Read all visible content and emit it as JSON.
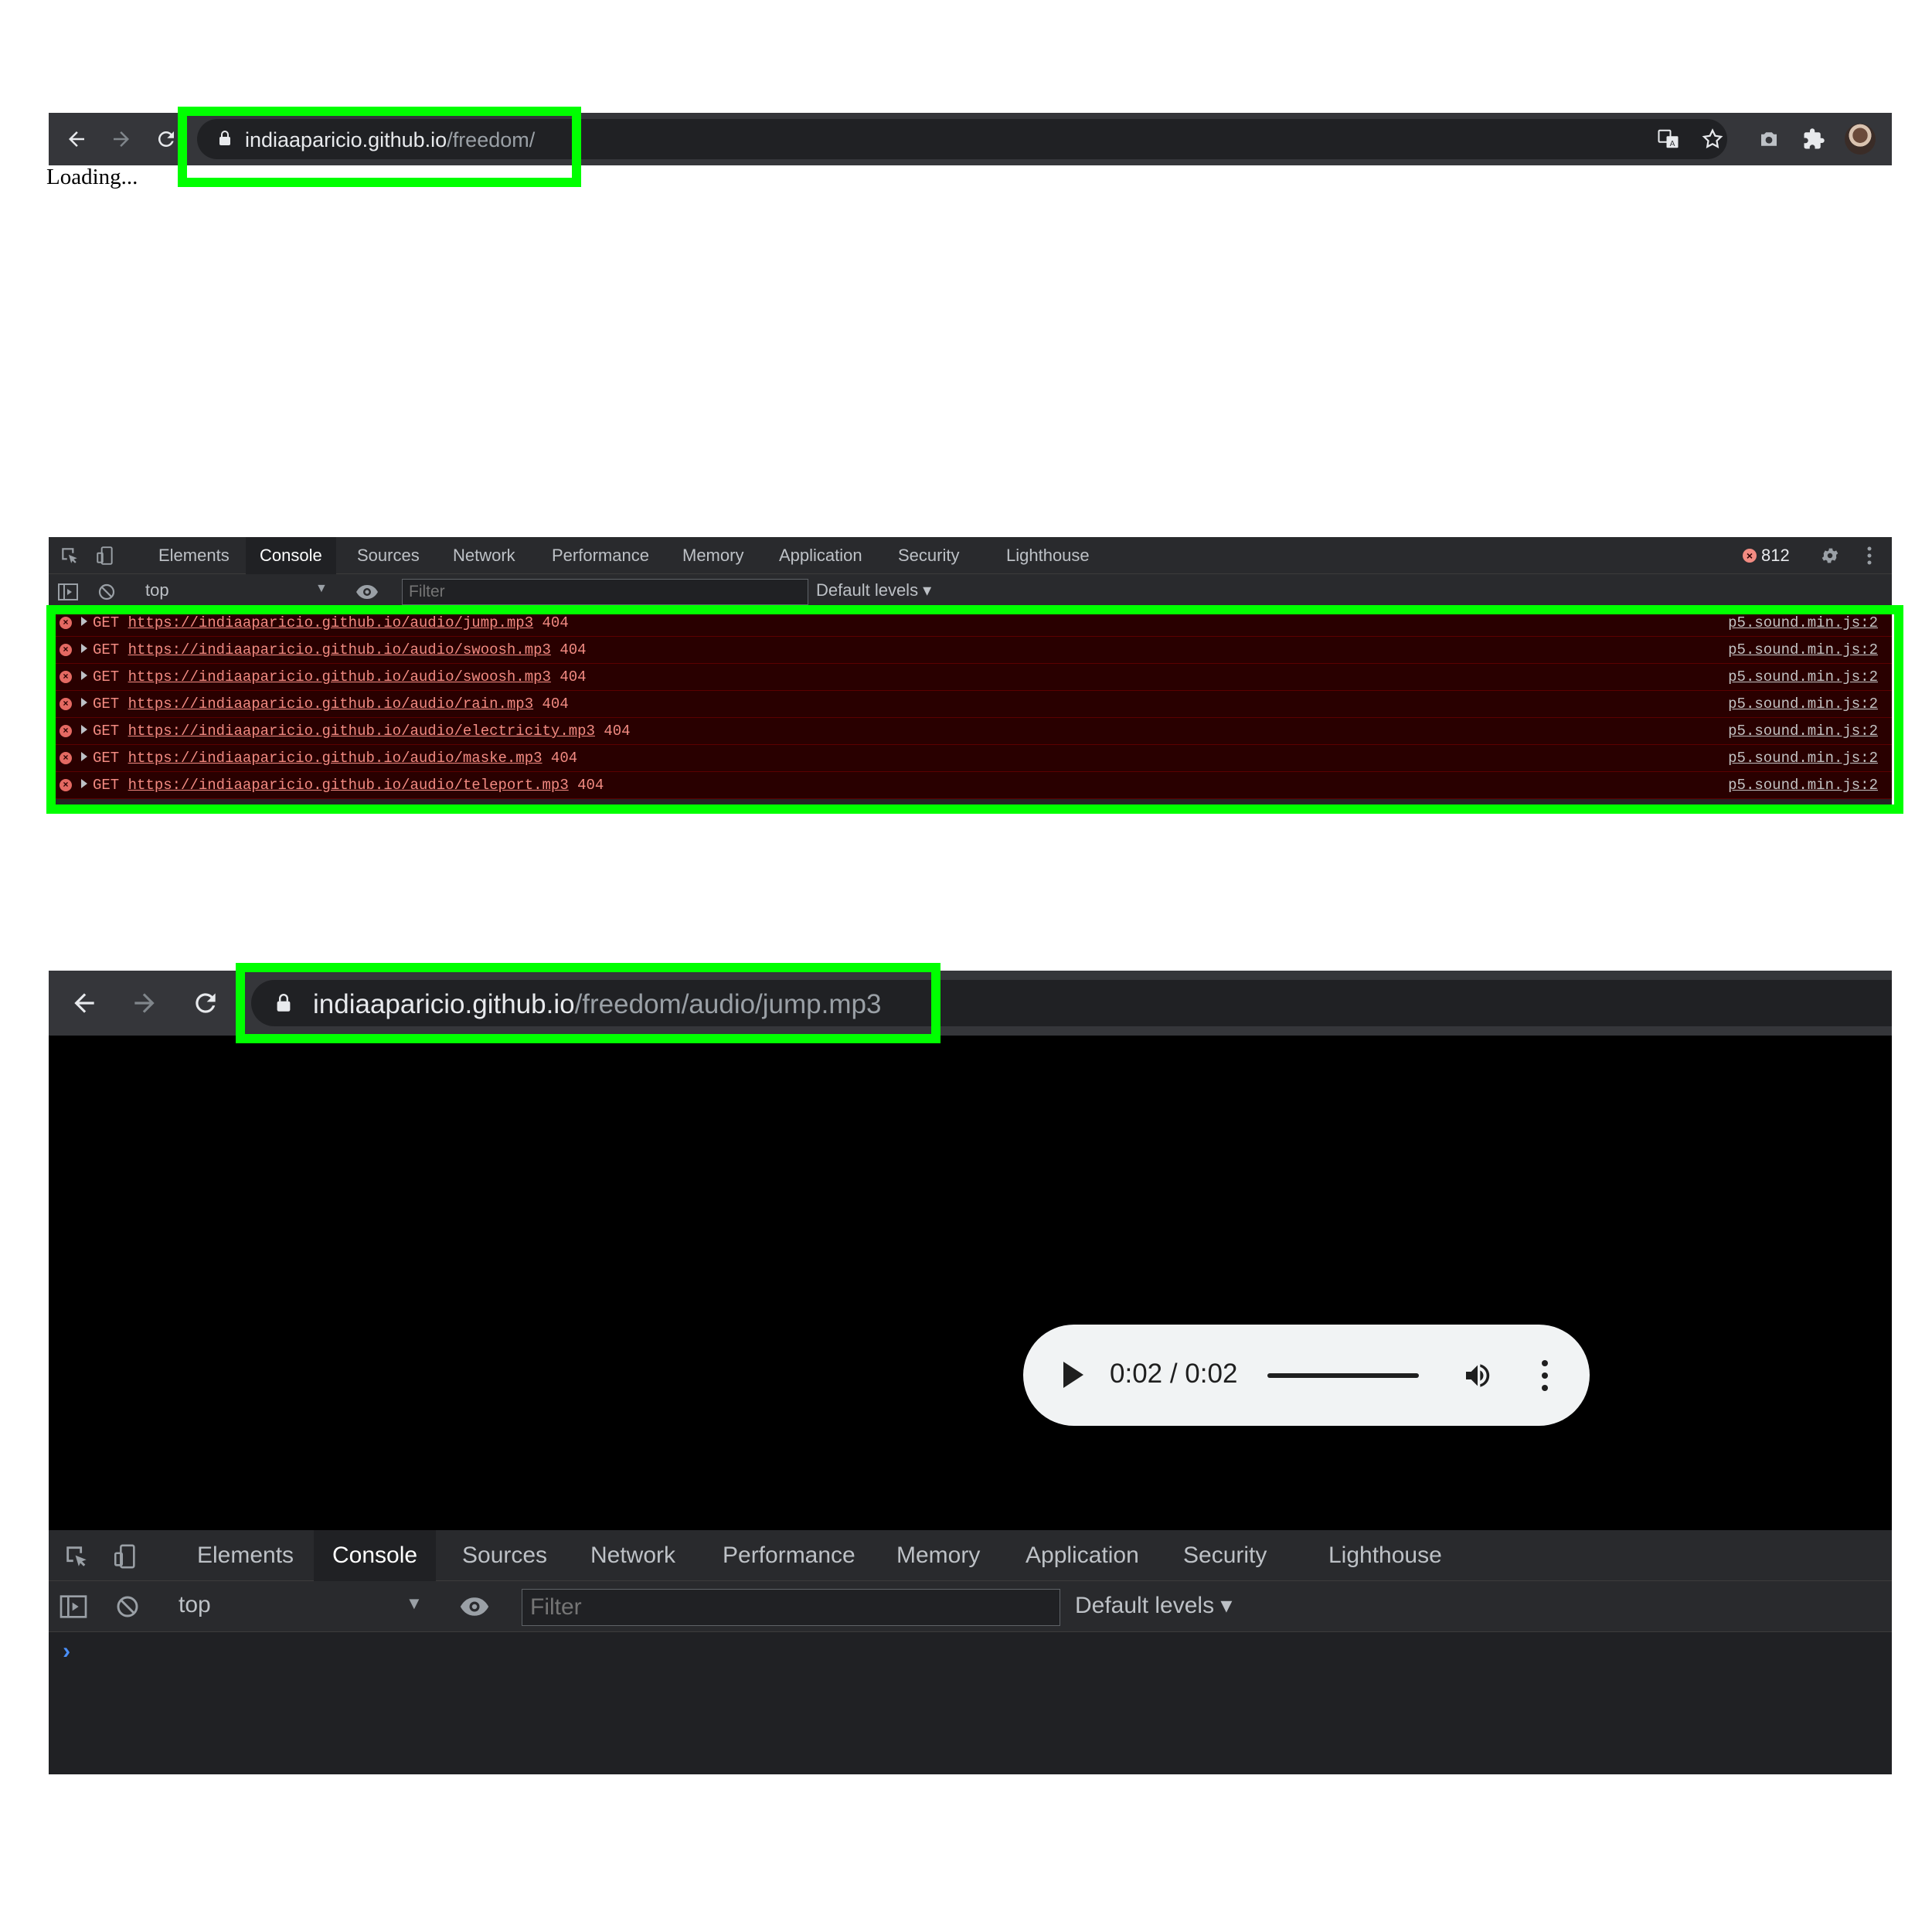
{
  "browser_top": {
    "url_host": "indiaaparicio.github.io",
    "url_path": "/freedom/",
    "page_text": "Loading..."
  },
  "devtools_top": {
    "tabs": [
      "Elements",
      "Console",
      "Sources",
      "Network",
      "Performance",
      "Memory",
      "Application",
      "Security",
      "Lighthouse"
    ],
    "active_tab": "Console",
    "context": "top",
    "filter_placeholder": "Filter",
    "levels": "Default levels ▾",
    "error_count": "812",
    "logs": [
      {
        "method": "GET",
        "url": "https://indiaaparicio.github.io/audio/jump.mp3",
        "status": "404",
        "source": "p5.sound.min.js:2"
      },
      {
        "method": "GET",
        "url": "https://indiaaparicio.github.io/audio/swoosh.mp3",
        "status": "404",
        "source": "p5.sound.min.js:2"
      },
      {
        "method": "GET",
        "url": "https://indiaaparicio.github.io/audio/swoosh.mp3",
        "status": "404",
        "source": "p5.sound.min.js:2"
      },
      {
        "method": "GET",
        "url": "https://indiaaparicio.github.io/audio/rain.mp3",
        "status": "404",
        "source": "p5.sound.min.js:2"
      },
      {
        "method": "GET",
        "url": "https://indiaaparicio.github.io/audio/electricity.mp3",
        "status": "404",
        "source": "p5.sound.min.js:2"
      },
      {
        "method": "GET",
        "url": "https://indiaaparicio.github.io/audio/maske.mp3",
        "status": "404",
        "source": "p5.sound.min.js:2"
      },
      {
        "method": "GET",
        "url": "https://indiaaparicio.github.io/audio/teleport.mp3",
        "status": "404",
        "source": "p5.sound.min.js:2"
      }
    ]
  },
  "browser_bottom": {
    "url_host": "indiaaparicio.github.io",
    "url_path": "/freedom/audio/jump.mp3",
    "player": {
      "time": "0:02 / 0:02",
      "progress": 1.0
    }
  },
  "devtools_bottom": {
    "tabs": [
      "Elements",
      "Console",
      "Sources",
      "Network",
      "Performance",
      "Memory",
      "Application",
      "Security",
      "Lighthouse"
    ],
    "active_tab": "Console",
    "context": "top",
    "filter_placeholder": "Filter",
    "levels": "Default levels ▾",
    "prompt": "›"
  },
  "colors": {
    "highlight": "#00ff00",
    "error_bg": "#290000",
    "error_text": "#f28b82"
  }
}
